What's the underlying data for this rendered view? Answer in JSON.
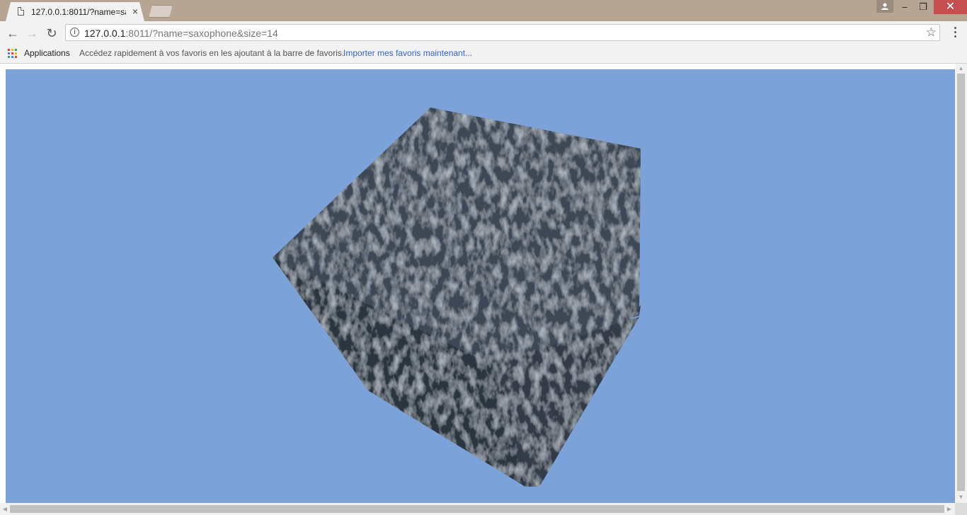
{
  "tab": {
    "title": "127.0.0.1:8011/?name=sa",
    "close_glyph": "×",
    "icon": "page-icon"
  },
  "window_controls": {
    "minimize_glyph": "–",
    "maximize_glyph": "❐",
    "close_glyph": "✕"
  },
  "toolbar": {
    "back_glyph": "←",
    "forward_glyph": "→",
    "reload_glyph": "↻",
    "info_glyph": "i",
    "url_host": "127.0.0.1",
    "url_rest": ":8011/?name=saxophone&size=14",
    "star_glyph": "☆"
  },
  "bookmarks": {
    "apps_label": "Applications",
    "hint": "Accédez rapidement à vos favoris en les ajoutant à la barre de favoris.",
    "import_link": "Importer mes favoris maintenant..."
  },
  "page": {
    "background_color": "#7da2d7",
    "object": "textured-cube",
    "cube_color": "#3a4450"
  },
  "scrollbars": {
    "up_glyph": "▲",
    "down_glyph": "▼",
    "left_glyph": "◀",
    "right_glyph": "▶"
  },
  "colors": {
    "titlebar": "#b7a593",
    "close_button": "#c74e4e",
    "link": "#3366cc"
  }
}
